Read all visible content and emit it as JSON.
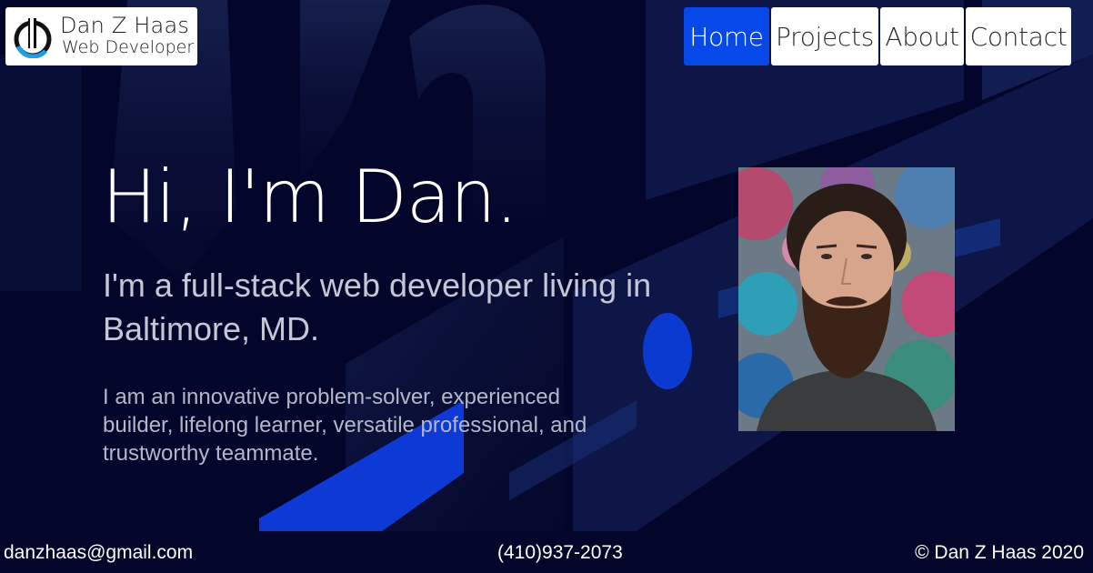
{
  "header": {
    "logo_name": "Dan Z Haas",
    "logo_subtitle": "Web Developer",
    "logo_icon": "dzh-monogram-icon"
  },
  "nav": {
    "items": [
      {
        "label": "Home",
        "active": true
      },
      {
        "label": "Projects",
        "active": false
      },
      {
        "label": "About",
        "active": false
      },
      {
        "label": "Contact",
        "active": false
      }
    ]
  },
  "hero": {
    "title": "Hi, I'm Dan.",
    "subtitle": "I'm a full-stack web developer living in Baltimore, MD.",
    "description": "I am an innovative problem-solver, experienced builder, lifelong learner, versatile professional, and trustworthy teammate.",
    "portrait_icon": "profile-photo"
  },
  "footer": {
    "email": "danzhaas@gmail.com",
    "phone": "(410)937-2073",
    "copyright": "© Dan Z Haas 2020"
  },
  "colors": {
    "background": "#04052a",
    "accent": "#0648e8",
    "nav_bg": "#ffffff",
    "text_muted": "#c5c7d6"
  }
}
